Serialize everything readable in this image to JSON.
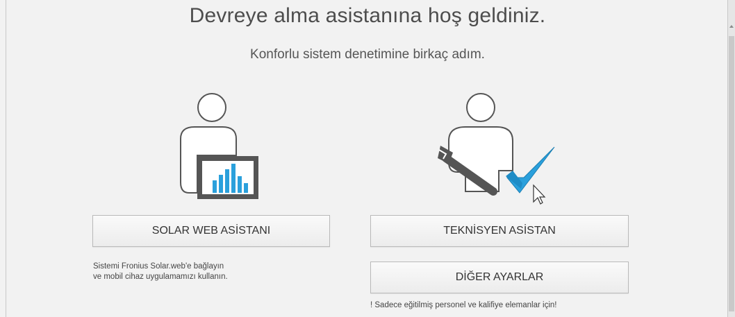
{
  "header": {
    "title": "Devreye alma asistanına hoş geldiniz.",
    "subtitle": "Konforlu sistem denetimine birkaç adım."
  },
  "left_option": {
    "icon": "user-with-monitor-chart-icon",
    "button_label": "SOLAR WEB ASİSTANI",
    "note_line1": "Sistemi Fronius Solar.web'e bağlayın",
    "note_line2": "ve mobil cihaz uygulamamızı kullanın."
  },
  "right_option": {
    "icon": "technician-wrench-checkmark-icon",
    "button_label": "TEKNİSYEN ASİSTAN",
    "other_button_label": "DİĞER AYARLAR",
    "note": "! Sadece eğitilmiş personel ve kalifiye elemanlar için!"
  },
  "colors": {
    "background": "#f2f2f2",
    "accent_blue": "#2aa0dc",
    "icon_gray": "#555555"
  }
}
